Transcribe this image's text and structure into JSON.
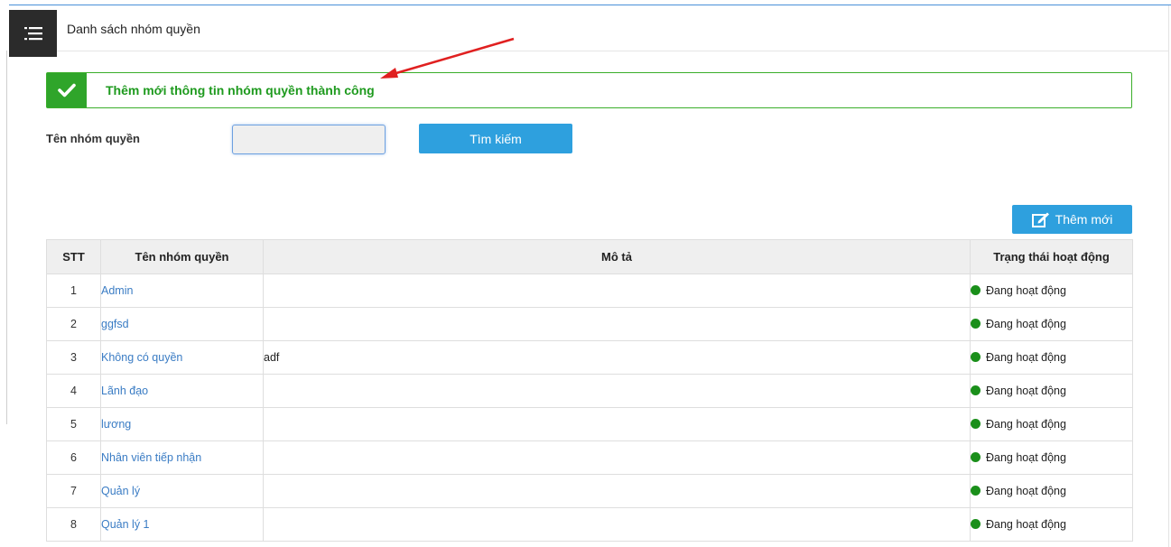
{
  "header": {
    "title": "Danh sách nhóm quyền"
  },
  "alert": {
    "message": "Thêm mới thông tin nhóm quyền thành công",
    "color": "#2fa52a"
  },
  "search": {
    "label": "Tên nhóm quyền",
    "value": "",
    "button_label": "Tìm kiếm"
  },
  "add_button_label": "Thêm mới",
  "table": {
    "headers": {
      "stt": "STT",
      "name": "Tên nhóm quyền",
      "desc": "Mô tả",
      "status": "Trạng thái hoạt động"
    },
    "rows": [
      {
        "stt": "1",
        "name": "Admin",
        "desc": "",
        "status": "Đang hoạt động"
      },
      {
        "stt": "2",
        "name": "ggfsd",
        "desc": "",
        "status": "Đang hoạt động"
      },
      {
        "stt": "3",
        "name": "Không có quyền",
        "desc": "adf",
        "status": "Đang hoạt động"
      },
      {
        "stt": "4",
        "name": "Lãnh đạo",
        "desc": "",
        "status": "Đang hoạt động"
      },
      {
        "stt": "5",
        "name": "lương",
        "desc": "",
        "status": "Đang hoạt động"
      },
      {
        "stt": "6",
        "name": "Nhân viên tiếp nhận",
        "desc": "",
        "status": "Đang hoạt động"
      },
      {
        "stt": "7",
        "name": "Quản lý",
        "desc": "",
        "status": "Đang hoạt động"
      },
      {
        "stt": "8",
        "name": "Quản lý 1",
        "desc": "",
        "status": "Đang hoạt động"
      }
    ]
  },
  "colors": {
    "primary": "#2ea0de",
    "link": "#3a7cc4",
    "status_active": "#1a8f1a",
    "annotation_arrow": "#e02020"
  }
}
